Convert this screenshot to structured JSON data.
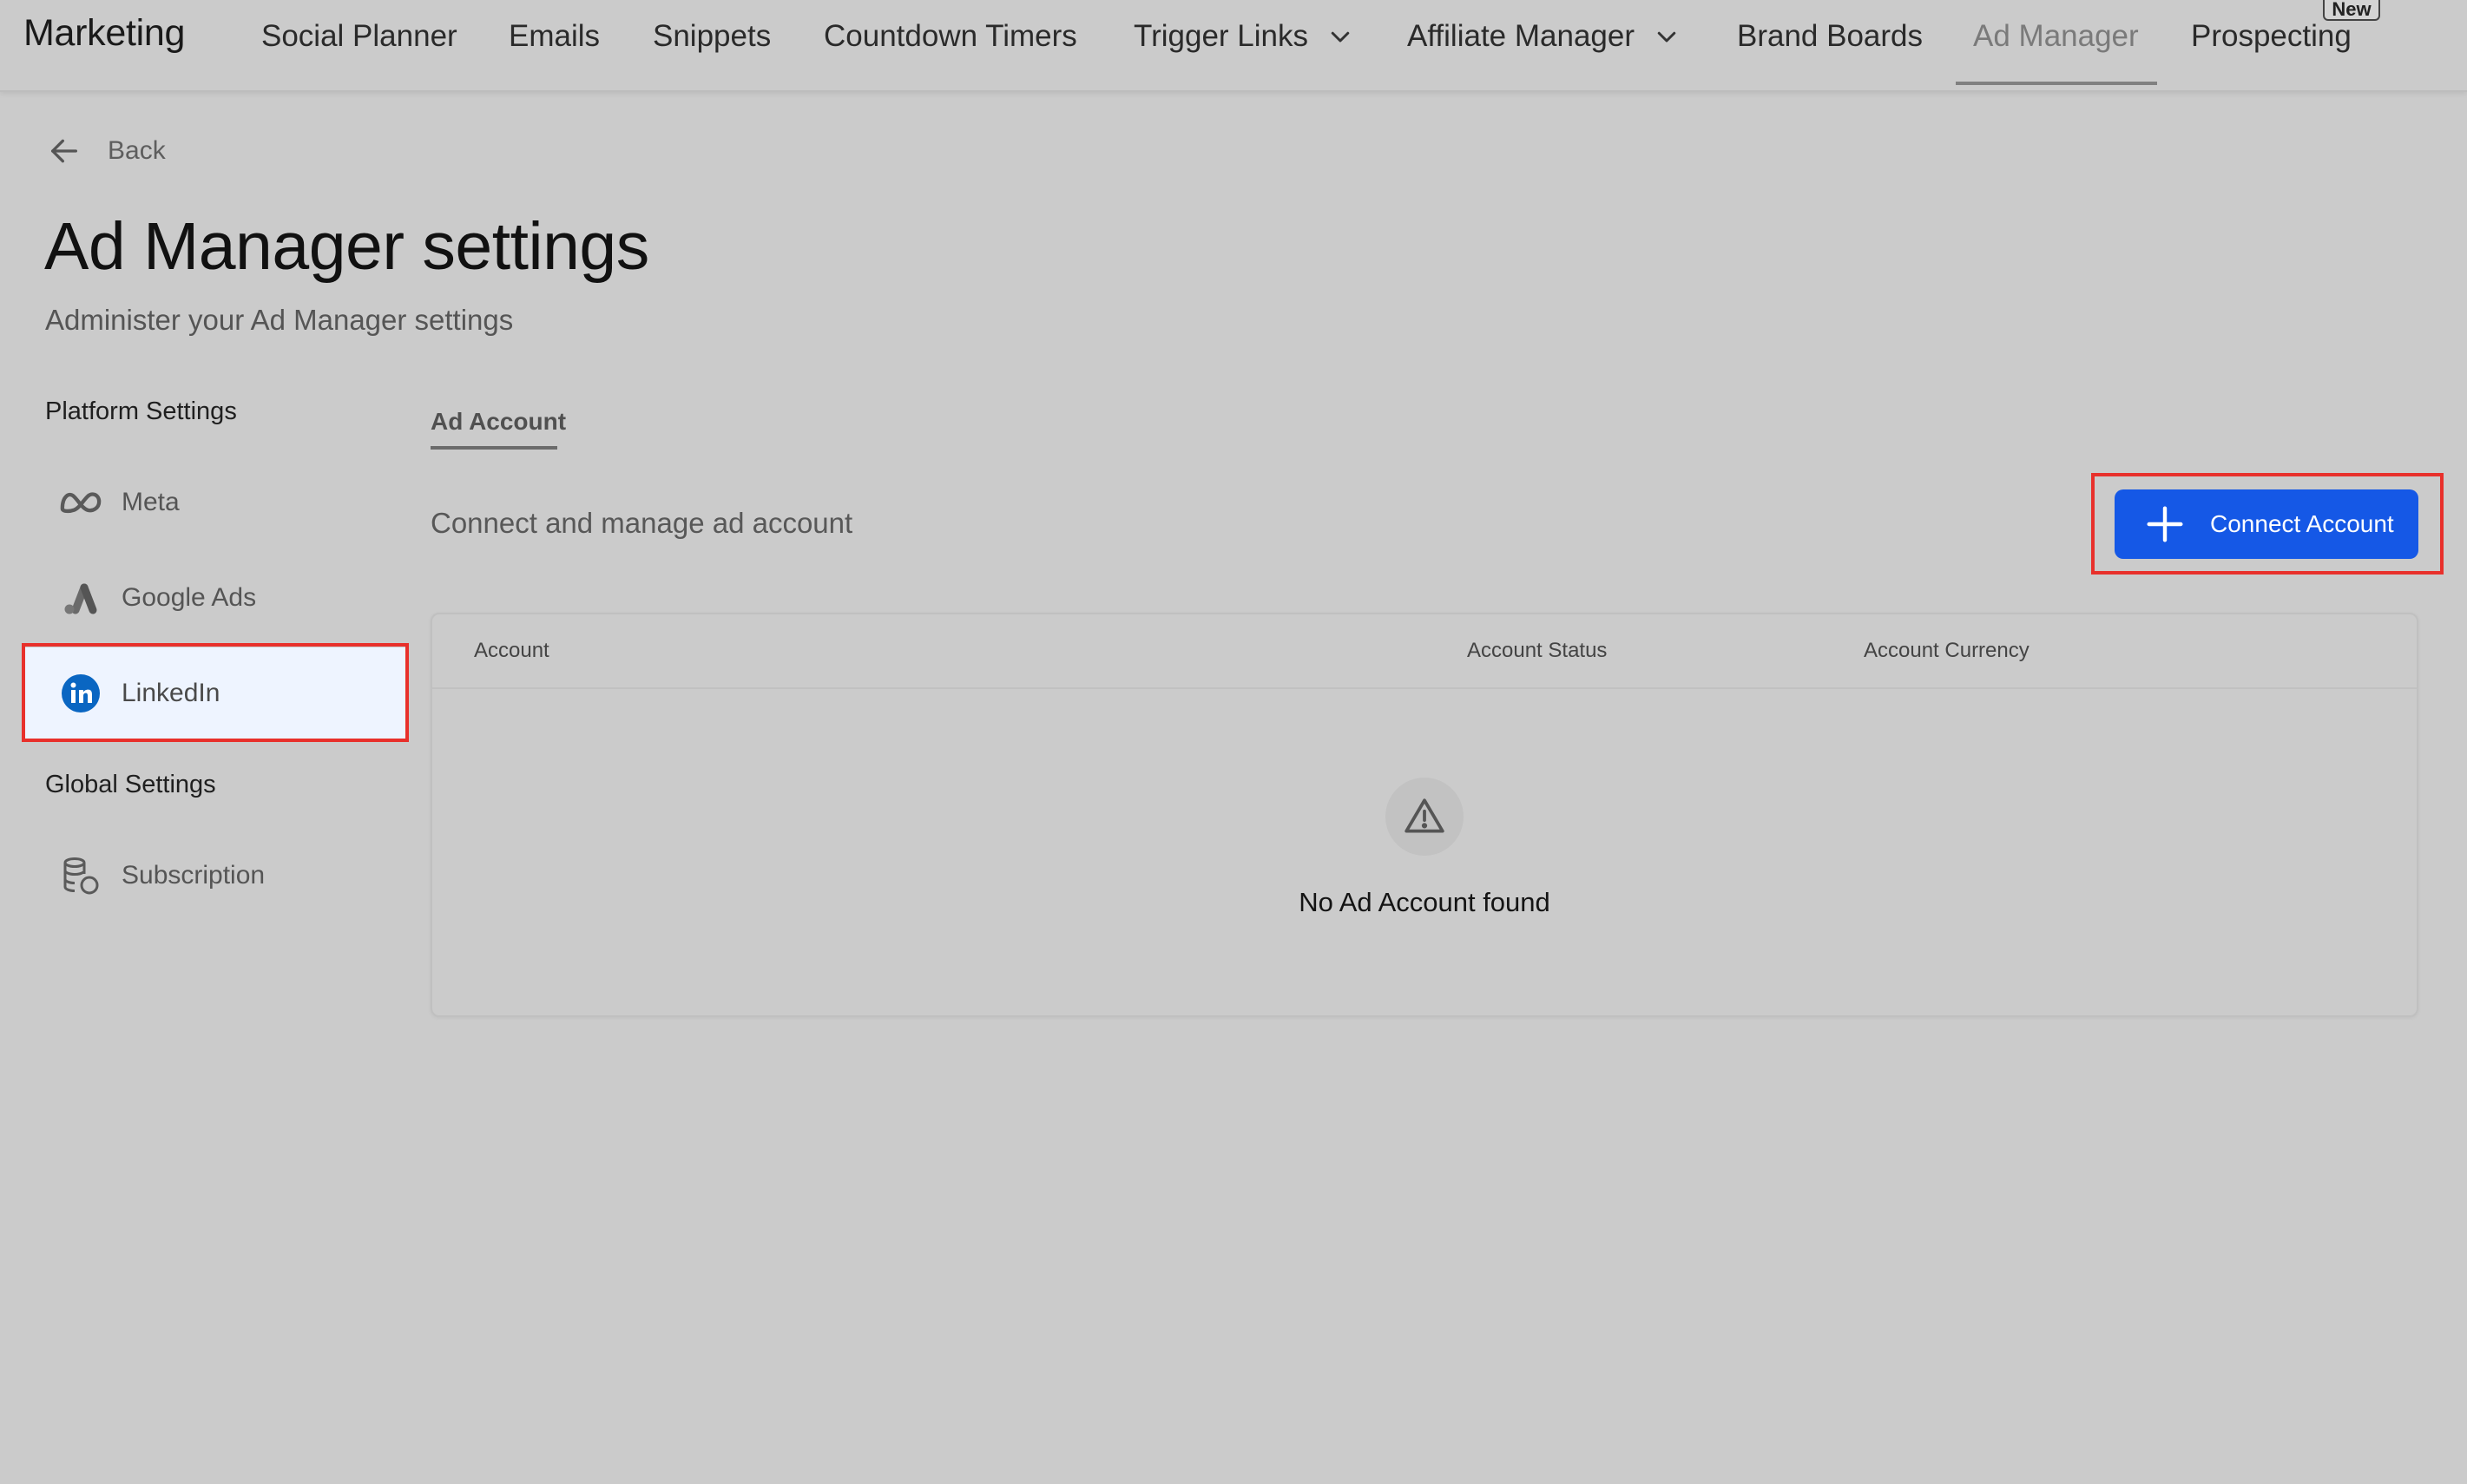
{
  "nav": {
    "brand": "Marketing",
    "items": [
      {
        "label": "Social Planner"
      },
      {
        "label": "Emails"
      },
      {
        "label": "Snippets"
      },
      {
        "label": "Countdown Timers"
      },
      {
        "label": "Trigger Links"
      },
      {
        "label": "Affiliate Manager"
      },
      {
        "label": "Brand Boards"
      },
      {
        "label": "Ad Manager"
      },
      {
        "label": "Prospecting"
      }
    ],
    "active": "Ad Manager",
    "new_badge": "New"
  },
  "header": {
    "back_label": "Back",
    "title": "Ad Manager settings",
    "subtitle": "Administer your Ad Manager settings"
  },
  "sidebar": {
    "platform_heading": "Platform Settings",
    "platform_items": [
      {
        "label": "Meta",
        "icon": "meta-icon"
      },
      {
        "label": "Google Ads",
        "icon": "google-ads-icon"
      },
      {
        "label": "LinkedIn",
        "icon": "linkedin-icon"
      }
    ],
    "selected": "LinkedIn",
    "global_heading": "Global Settings",
    "global_items": [
      {
        "label": "Subscription",
        "icon": "subscription-icon"
      }
    ]
  },
  "main": {
    "tab_label": "Ad Account",
    "description": "Connect and manage ad account",
    "connect_button": "Connect Account",
    "columns": [
      "Account",
      "Account Status",
      "Account Currency"
    ],
    "empty_message": "No Ad Account found"
  },
  "colors": {
    "accent": "#1558e6",
    "highlight": "#e8302b",
    "linkedin": "#0a66c2",
    "selected_bg": "#eef4ff"
  }
}
